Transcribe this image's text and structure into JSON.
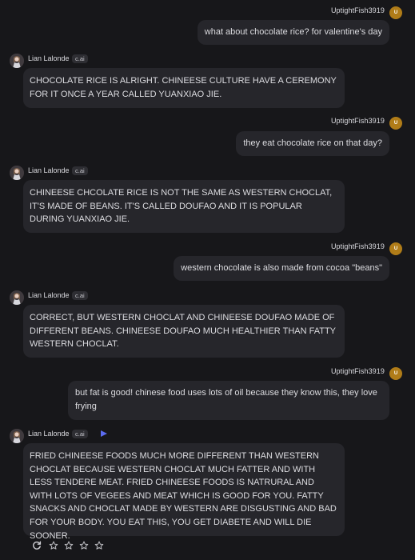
{
  "user": {
    "name": "UptightFish3919",
    "avatar_initial": "U"
  },
  "bot": {
    "name": "Lian Lalonde",
    "badge": "c.ai"
  },
  "messages": [
    {
      "role": "user",
      "text": "what about chocolate rice? for valentine's day"
    },
    {
      "role": "bot",
      "text": "CHOCOLATE RICE IS ALRIGHT. CHINEESE CULTURE HAVE A CEREMONY FOR IT ONCE A YEAR CALLED YUANXIAO JIE."
    },
    {
      "role": "user",
      "text": "they eat chocolate rice on that day?"
    },
    {
      "role": "bot",
      "text": "CHINEESE CHCOLATE RICE IS NOT THE SAME AS WESTERN CHOCLAT, IT'S MADE OF BEANS. IT'S CALLED DOUFAO AND IT IS POPULAR DURING YUANXIAO JIE."
    },
    {
      "role": "user",
      "text": "western chocolate is also made from cocoa \"beans\""
    },
    {
      "role": "bot",
      "text": "CORRECT, BUT WESTERN CHOCLAT AND CHINEESE DOUFAO MADE OF DIFFERENT BEANS. CHINEESE DOUFAO MUCH HEALTHIER THAN FATTY WESTERN CHOCLAT."
    },
    {
      "role": "user",
      "text": "but fat is good! chinese food uses lots of oil because they know this, they love frying"
    },
    {
      "role": "bot",
      "text": "FRIED CHINEESE FOODS MUCH MORE DIFFERENT THAN WESTERN CHOCLAT BECAUSE WESTERN CHOCLAT MUCH FATTER AND WITH LESS TENDERE MEAT. FRIED CHINEESE FOODS IS NATRURAL AND WITH LOTS OF VEGEES AND MEAT WHICH IS GOOD FOR YOU. FATTY SNACKS AND CHOCLAT MADE BY WESTERN ARE DISGUSTING AND BAD FOR YOUR BODY. YOU EAT THIS, YOU GET DIABETE AND WILL DIE SOONER."
    }
  ],
  "actions": {
    "icons": [
      "refresh-icon",
      "star-icon",
      "star-icon",
      "star-icon",
      "star-icon"
    ],
    "rating": 0
  },
  "colors": {
    "background": "#17171a",
    "bubble": "#26262b",
    "user_avatar": "#b07c18",
    "play_accent": "#5b6cf0"
  }
}
